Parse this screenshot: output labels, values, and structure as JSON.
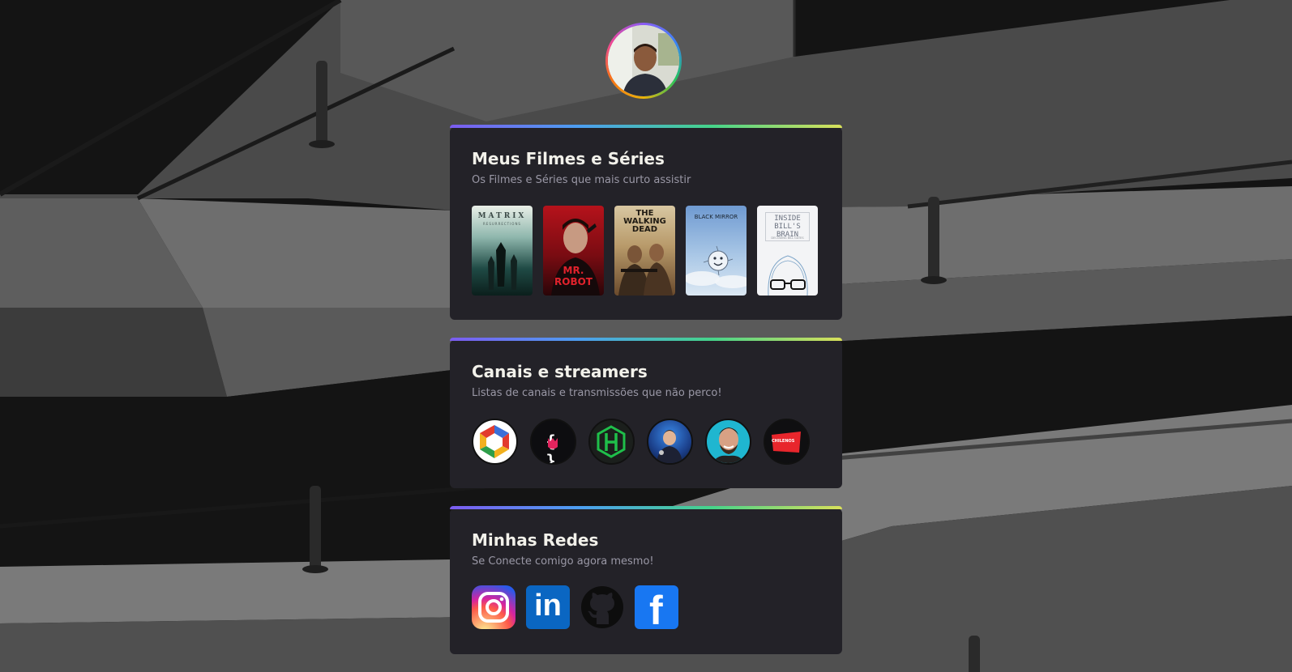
{
  "profile": {
    "avatar_icon": "profile-photo"
  },
  "movies": {
    "title": "Meus Filmes e Séries",
    "subtitle": "Os Filmes e Séries que mais curto assistir",
    "items": [
      {
        "name": "MATRIX",
        "tagline": "RESURRECTIONS"
      },
      {
        "name": "MR. ROBOT"
      },
      {
        "name": "THE WALKING DEAD"
      },
      {
        "name": "BLACK MIRROR"
      },
      {
        "name": "INSIDE BILL'S BRAIN",
        "tagline": "DECODING BILL GATES"
      }
    ]
  },
  "channels": {
    "title": "Canais e streamers",
    "subtitle": "Listas de canais e transmissões que não perco!",
    "items": [
      {
        "icon": "channel-logo-cube-icon"
      },
      {
        "icon": "channel-logo-code-rock-icon",
        "text": "{ }"
      },
      {
        "icon": "channel-logo-hexagon-icon"
      },
      {
        "icon": "channel-avatar-streamer-icon"
      },
      {
        "icon": "channel-avatar-person-icon"
      },
      {
        "icon": "channel-logo-play-icon",
        "text": "CHILENOS"
      }
    ]
  },
  "networks": {
    "title": "Minhas Redes",
    "subtitle": "Se Conecte comigo agora mesmo!",
    "items": [
      {
        "icon": "instagram-icon"
      },
      {
        "icon": "linkedin-icon",
        "text": "in"
      },
      {
        "icon": "github-icon"
      },
      {
        "icon": "facebook-icon",
        "text": "f"
      }
    ]
  }
}
